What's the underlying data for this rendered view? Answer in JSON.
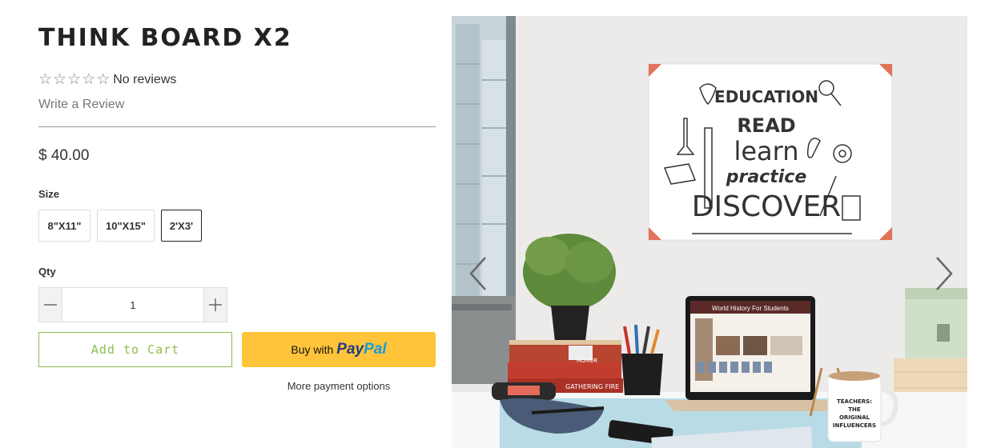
{
  "product": {
    "title": "THINK BOARD X2",
    "rating_text": "No reviews",
    "stars": 0,
    "stars_total": 5,
    "write_review": "Write a Review",
    "price": "$ 40.00"
  },
  "size": {
    "label": "Size",
    "options": [
      "8\"X11\"",
      "10\"X15\"",
      "2'X3'"
    ],
    "selected": "2'X3'"
  },
  "quantity": {
    "label": "Qty",
    "value": "1"
  },
  "actions": {
    "add_to_cart": "Add to Cart",
    "paypal_prefix": "Buy with",
    "paypal_brand_1": "Pay",
    "paypal_brand_2": "Pal",
    "more_payment": "More payment options"
  },
  "gallery": {
    "poster_words": [
      "EDUCATION",
      "READ",
      "learn",
      "practice",
      "DISCOVER"
    ],
    "laptop_title": "World History For Students",
    "mug_text": [
      "TEACHERS:",
      "THE",
      "ORIGINAL",
      "INFLUENCERS"
    ],
    "book_labels": [
      "HOMER",
      "GATHERING FIRE"
    ],
    "colors": {
      "accent_green": "#8cbf4a",
      "paypal_yellow": "#ffc439",
      "paypal_dark": "#253b80",
      "paypal_light": "#179bd7"
    }
  }
}
